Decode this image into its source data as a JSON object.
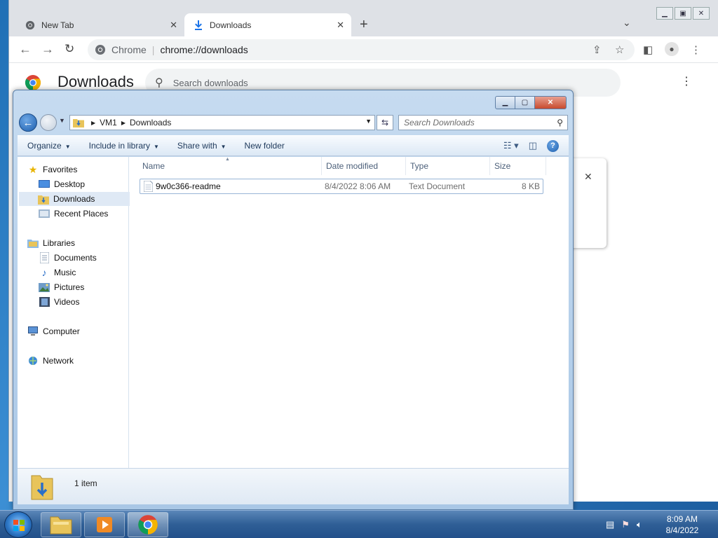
{
  "chrome": {
    "tabs": [
      {
        "title": "New Tab",
        "icon": "chrome-icon"
      },
      {
        "title": "Downloads",
        "icon": "download-icon"
      }
    ],
    "omnibox": {
      "site": "Chrome",
      "url": "chrome://downloads"
    },
    "page": {
      "title": "Downloads",
      "search_placeholder": "Search downloads"
    }
  },
  "explorer": {
    "breadcrumb": [
      "VM1",
      "Downloads"
    ],
    "search_placeholder": "Search Downloads",
    "commands": [
      "Organize",
      "Include in library",
      "Share with",
      "New folder"
    ],
    "nav": {
      "favorites": {
        "label": "Favorites",
        "items": [
          "Desktop",
          "Downloads",
          "Recent Places"
        ]
      },
      "libraries": {
        "label": "Libraries",
        "items": [
          "Documents",
          "Music",
          "Pictures",
          "Videos"
        ]
      },
      "computer": "Computer",
      "network": "Network"
    },
    "columns": [
      "Name",
      "Date modified",
      "Type",
      "Size"
    ],
    "files": [
      {
        "name": "9w0c366-readme",
        "date_modified": "8/4/2022 8:06 AM",
        "type": "Text Document",
        "size": "8 KB"
      }
    ],
    "status": "1 item"
  },
  "taskbar": {
    "clock_time": "8:09 AM",
    "clock_date": "8/4/2022"
  },
  "colors": {
    "selection": "#dfe9f5",
    "taskbar": "#2f5f96",
    "accent": "#1a73e8"
  }
}
